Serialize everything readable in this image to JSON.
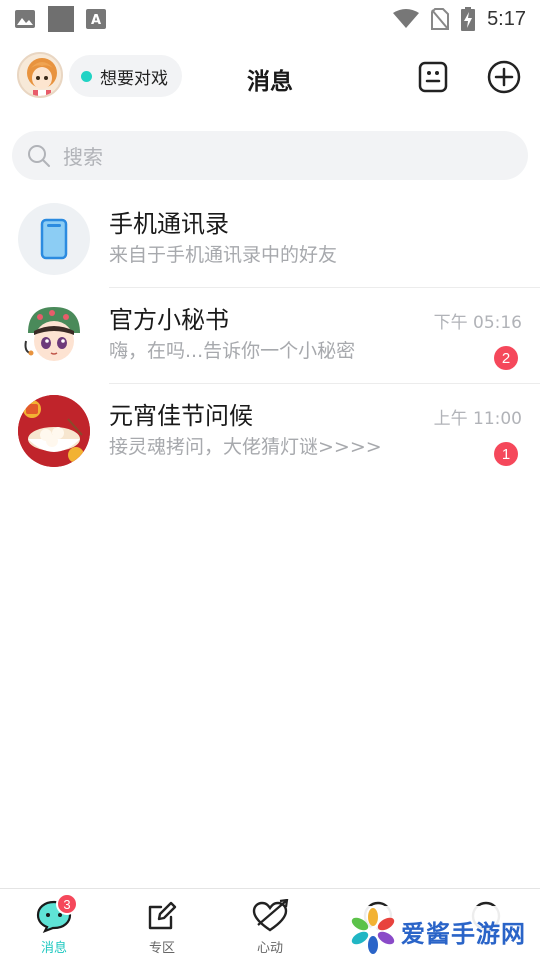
{
  "status_bar": {
    "time": "5:17",
    "icons": [
      "image-icon",
      "app-square-icon",
      "accessibility-a-icon",
      "wifi-icon",
      "no-sim-icon",
      "battery-charging-icon"
    ]
  },
  "header": {
    "title": "消息",
    "status_text": "想要对戏",
    "status_color": "#21d3c4",
    "right_icons": [
      "robot-face-icon",
      "add-circle-icon"
    ]
  },
  "search": {
    "placeholder": "搜索"
  },
  "conversations": [
    {
      "name": "手机通讯录",
      "preview": "来自于手机通讯录中的好友",
      "time": "",
      "unread": "",
      "avatar": "phone-contacts-icon"
    },
    {
      "name": "官方小秘书",
      "preview": "嗨，在吗...告诉你一个小秘密",
      "time": "下午 05:16",
      "unread": "2",
      "avatar": "secretary-avatar"
    },
    {
      "name": "元宵佳节问候",
      "preview": "接灵魂拷问，大佬猜灯谜>>>>",
      "time": "上午 11:00",
      "unread": "1",
      "avatar": "lantern-festival-avatar"
    }
  ],
  "bottom_nav": {
    "items": [
      {
        "label": "消息",
        "icon": "chat-bubble-icon",
        "active": true,
        "badge": "3"
      },
      {
        "label": "专区",
        "icon": "edit-square-icon",
        "active": false,
        "badge": ""
      },
      {
        "label": "心动",
        "icon": "heart-arrow-icon",
        "active": false,
        "badge": ""
      },
      {
        "label": "",
        "icon": "discover-icon",
        "active": false,
        "badge": ""
      },
      {
        "label": "",
        "icon": "profile-icon",
        "active": false,
        "badge": ""
      }
    ]
  },
  "watermark": {
    "text": "爱酱手游网"
  },
  "colors": {
    "accent": "#1ec8c0",
    "badge": "#f5485b",
    "muted_text": "#a7a9ad"
  }
}
